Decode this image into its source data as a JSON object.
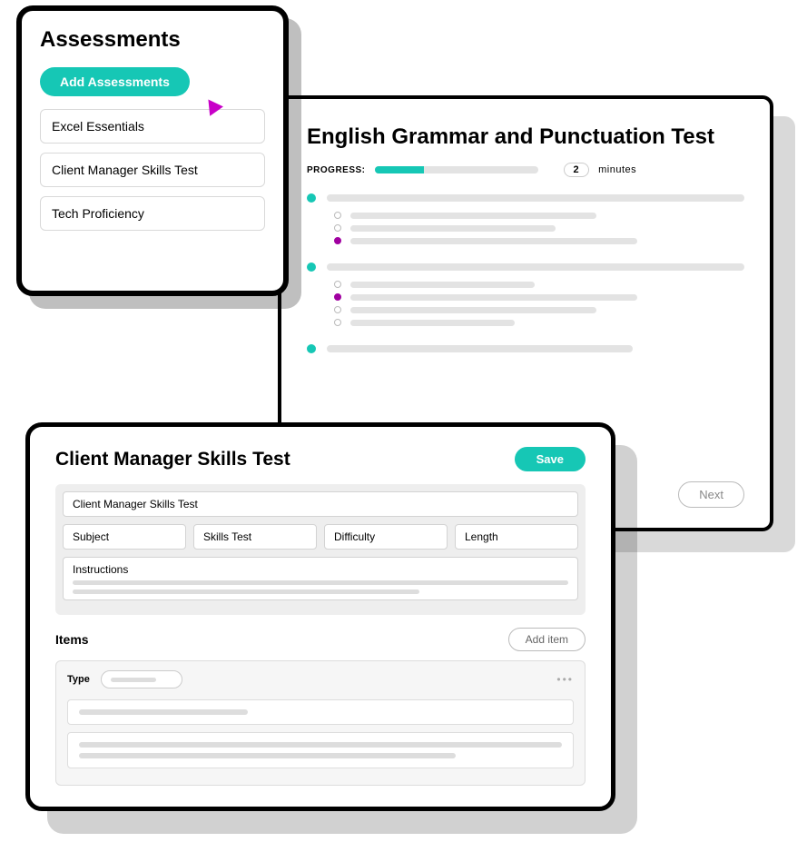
{
  "assessments": {
    "title": "Assessments",
    "add_label": "Add Assessments",
    "items": [
      "Excel Essentials",
      "Client Manager Skills Test",
      "Tech Proficiency"
    ]
  },
  "test": {
    "title": "English Grammar and Punctuation Test",
    "progress_label": "PROGRESS:",
    "minutes_value": "2",
    "minutes_label": "minutes",
    "next_label": "Next"
  },
  "editor": {
    "title": "Client Manager Skills Test",
    "save_label": "Save",
    "field_title": "Client Manager Skills Test",
    "field_subject": "Subject",
    "field_skills": "Skills Test",
    "field_difficulty": "Difficulty",
    "field_length": "Length",
    "field_instructions": "Instructions",
    "items_title": "Items",
    "add_item_label": "Add item",
    "type_label": "Type"
  }
}
